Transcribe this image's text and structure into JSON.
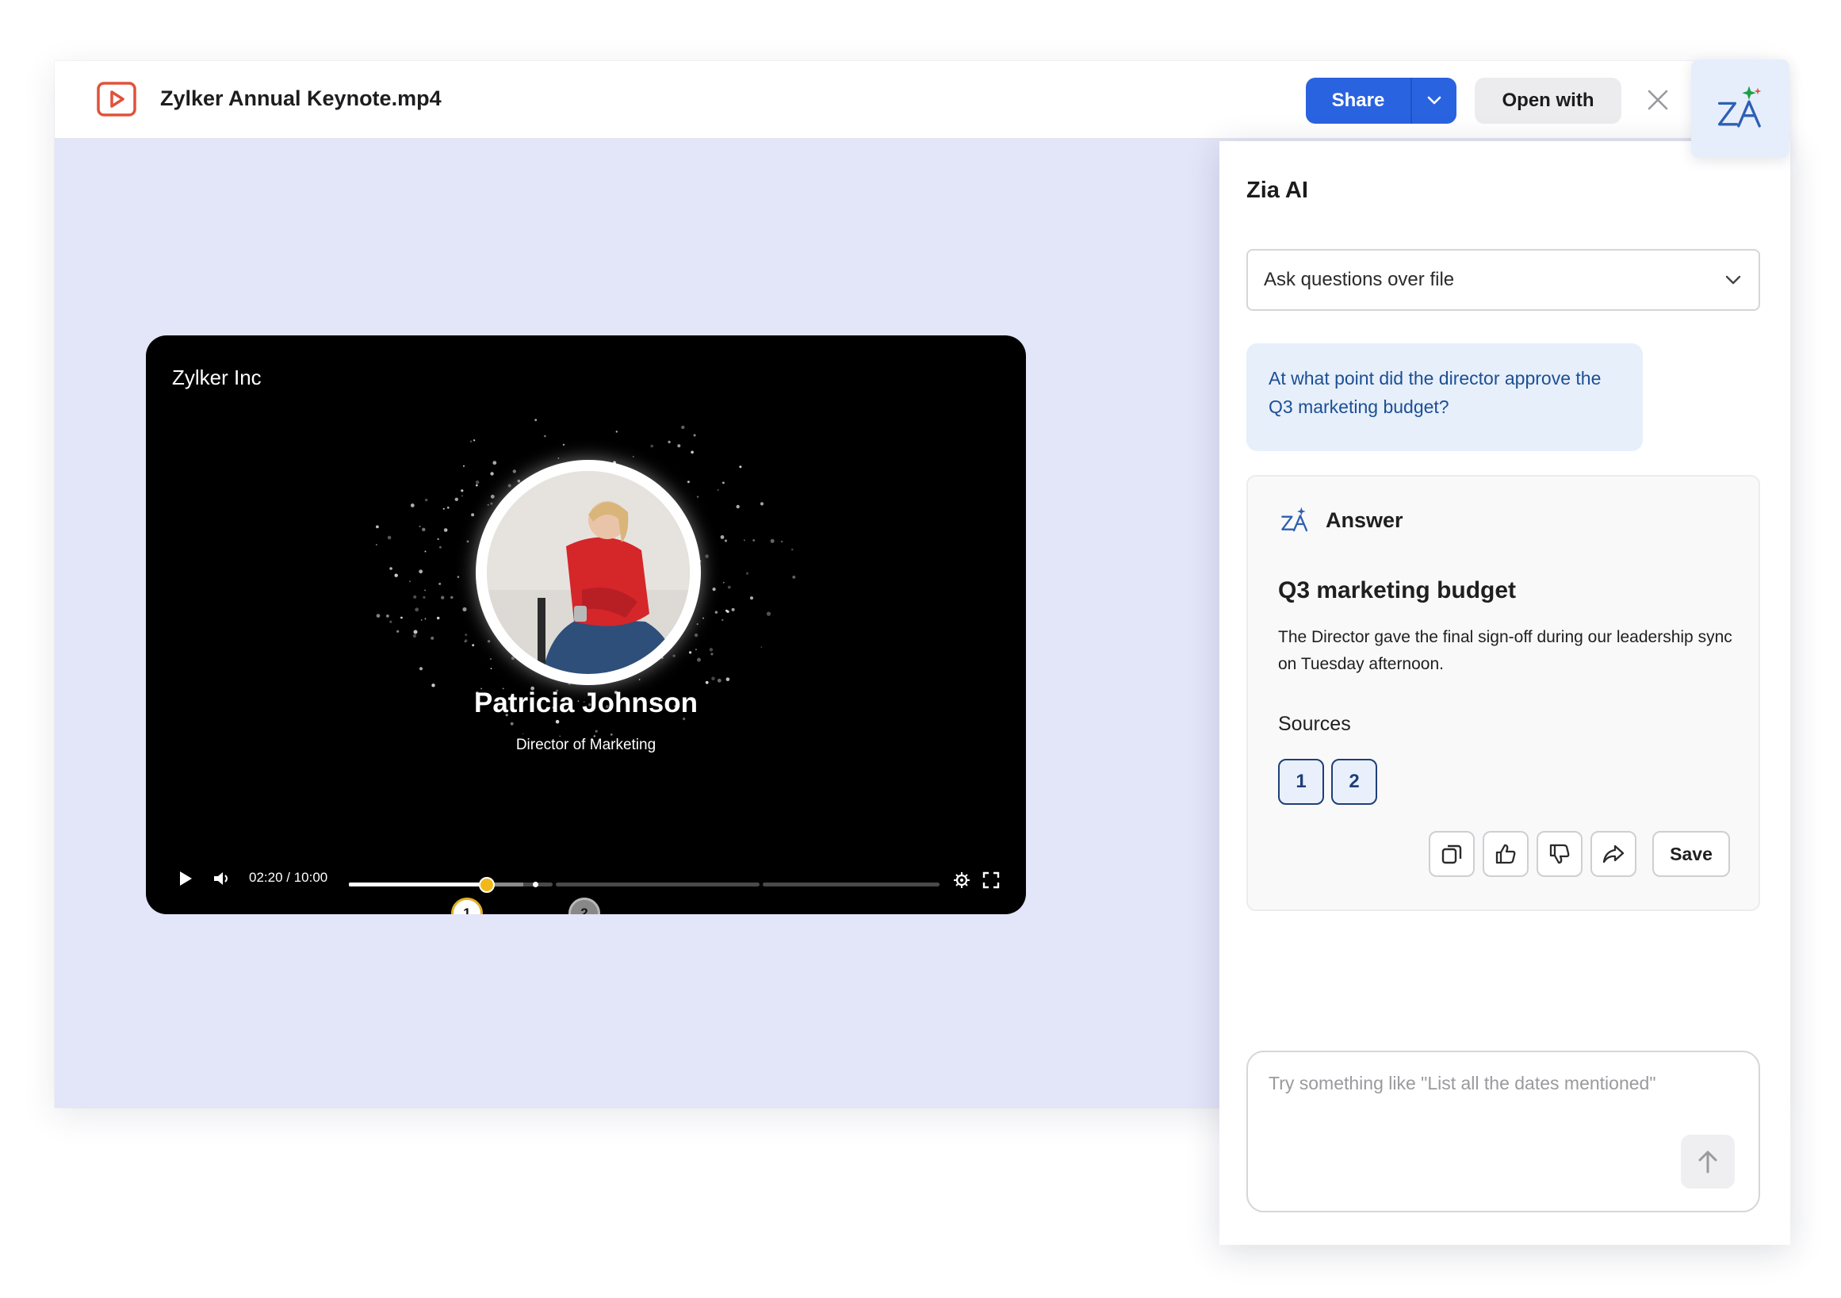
{
  "window": {
    "file_name": "Zylker Annual Keynote.mp4",
    "share_label": "Share",
    "open_with_label": "Open with",
    "icons": {
      "file": "video-file-icon",
      "close": "close-icon",
      "share_menu": "chevron-down-icon"
    }
  },
  "player": {
    "brand": "Zylker Inc",
    "person_name": "Patricia Johnson",
    "person_role": "Director of Marketing",
    "timecode": "02:20 / 10:00",
    "progress_fraction": 0.233,
    "markers": [
      {
        "label": "1"
      },
      {
        "label": "2"
      }
    ],
    "icons": {
      "play": "play-icon",
      "volume": "volume-icon",
      "settings": "gear-icon",
      "fullscreen": "fullscreen-icon"
    }
  },
  "zia": {
    "title": "Zia AI",
    "mode_selected": "Ask questions over file",
    "question": "At what point did the director approve the Q3 marketing budget?",
    "answer": {
      "label": "Answer",
      "heading": "Q3 marketing budget",
      "body": "The Director gave the final sign-off during our leadership sync on Tuesday afternoon.",
      "sources_label": "Sources",
      "sources": [
        "1",
        "2"
      ],
      "save_label": "Save",
      "actions": [
        "copy-icon",
        "thumbs-up-icon",
        "thumbs-down-icon",
        "forward-icon"
      ]
    },
    "prompt_placeholder": "Try something like \"List all the dates mentioned\"",
    "icons": {
      "zia": "zia-ai-icon",
      "send": "send-arrow-icon"
    }
  },
  "colors": {
    "accent": "#2a63e0",
    "viewer_background": "#e3e5f8",
    "question_bubble": "#e7effb",
    "marker_active": "#f2b81a",
    "file_icon": "#e0523a"
  }
}
